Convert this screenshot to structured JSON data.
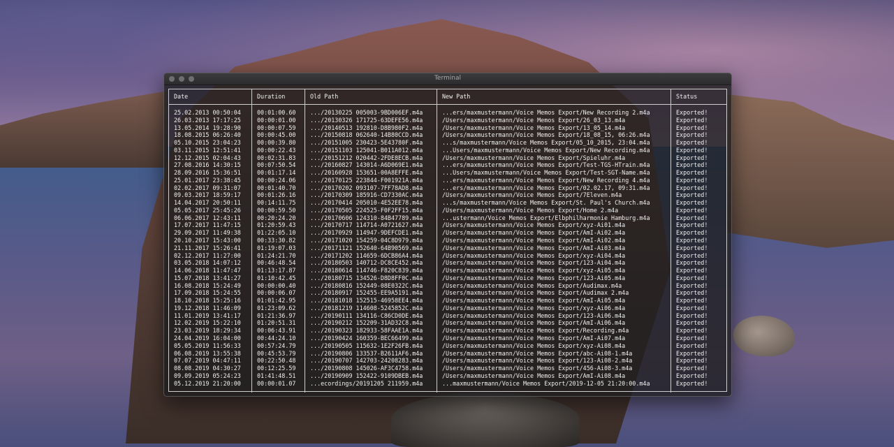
{
  "window": {
    "title": "Terminal"
  },
  "table": {
    "headers": [
      "Date",
      "Duration",
      "Old Path",
      "New Path",
      "Status"
    ],
    "rows": [
      [
        "25.02.2013 00:50:04",
        "00:01:00.60",
        ".../20130225 005003-9BD006EF.m4a",
        "...ers/maxmustermann/Voice Memos Export/New Recording 2.m4a",
        "Exported!"
      ],
      [
        "26.03.2013 17:17:25",
        "00:00:01.00",
        ".../20130326 171725-63DEFE56.m4a",
        "/Users/maxmustermann/Voice Memos Export/26_03_13.m4a",
        "Exported!"
      ],
      [
        "13.05.2014 19:28:90",
        "00:00:07.59",
        ".../20140513 192810-D8B980F2.m4a",
        "/Users/maxmustermann/Voice Memos Export/13_05_14.m4a",
        "Exported!"
      ],
      [
        "18.08.2015 06:26:40",
        "00:00:45.00",
        ".../20150818 062640-14B80CCD.m4a",
        "/Users/maxmustermann/Voice Memos Export/18_08_15, 06:26.m4a",
        "Exported!"
      ],
      [
        "05.10.2015 23:04:23",
        "00:00:39.80",
        ".../20151005 230423-5E43780F.m4a",
        "...s/maxmustermann/Voice Memos Export/05_10_2015, 23:04.m4a",
        "Exported!"
      ],
      [
        "03.11.2015 12:51:41",
        "00:00:22.43",
        ".../20151103 125041-B011A012.m4a",
        "...Users/maxmustermann/Voice Memos Export/New Recording.m4a",
        "Exported!"
      ],
      [
        "12.12.2015 02:04:43",
        "00:02:31.83",
        ".../20151212 020442-2FDE8ECB.m4a",
        "/Users/maxmustermann/Voice Memos Export/Spieluhr.m4a",
        "Exported!"
      ],
      [
        "27.08.2016 14:30:15",
        "00:07:50.54",
        ".../20160827 143014-A6D069E1.m4a",
        "...ers/maxmustermann/Voice Memos Export/Test-TGS-HTrain.m4a",
        "Exported!"
      ],
      [
        "28.09.2016 15:36:51",
        "00:01:17.14",
        ".../20160928 153651-00A8EFFE.m4a",
        "...Users/maxmustermann/Voice Memos Export/Test-SGT-Name.m4a",
        "Exported!"
      ],
      [
        "25.01.2017 23:38:45",
        "00:00:24.06",
        ".../20170125 223844-F001921A.m4a",
        "...ers/maxmustermann/Voice Memos Export/New Recording 4.m4a",
        "Exported!"
      ],
      [
        "02.02.2017 09:31:07",
        "00:01:40.70",
        ".../20170202 093107-7FF78AD8.m4a",
        "...ers/maxmustermann/Voice Memos Export/02.02.17, 09:31.m4a",
        "Exported!"
      ],
      [
        "09.03.2017 18:59:17",
        "00:01:26.16",
        ".../20170309 185916-CD7330AC.m4a",
        "/Users/maxmustermann/Voice Memos Export/7Eleven.m4a",
        "Exported!"
      ],
      [
        "14.04.2017 20:50:11",
        "00:14:11.75",
        ".../20170414 205010-4E52EE78.m4a",
        "...s/maxmustermann/Voice Memos Export/St. Paul's Church.m4a",
        "Exported!"
      ],
      [
        "05.05.2017 25:45:26",
        "00:00:59.50",
        ".../20170505 224525-F0F2FF15.m4a",
        "/Users/maxmustermann/Voice Memos Export/Home 2.m4a",
        "Exported!"
      ],
      [
        "06.06.2017 12:43:11",
        "00:20:24.20",
        ".../20170606 124310-84B47789.m4a",
        "...ustermann/Voice Memos Export/Elbphilharmonie Hamburg.m4a",
        "Exported!"
      ],
      [
        "17.07.2017 11:47:15",
        "01:20:59.43",
        ".../20170717 114714-A0721627.m4a",
        "/Users/maxmustermann/Voice Memos Export/xyz-Ai01.m4a",
        "Exported!"
      ],
      [
        "29.09.2017 11:49:38",
        "01:22:05.10",
        ".../20170929 114947-9DEFCDE1.m4a",
        "/Users/maxmustermann/Voice Memos Export/AmI-Ai02.m4a",
        "Exported!"
      ],
      [
        "20.10.2017 15:43:00",
        "00:33:30.82",
        ".../20171020 154259-04C8D979.m4a",
        "/Users/maxmustermann/Voice Memos Export/AmI-Ai02.m4a",
        "Exported!"
      ],
      [
        "21.11.2017 15:26:41",
        "01:19:07.03",
        ".../20171121 152640-64B90569.m4a",
        "/Users/maxmustermann/Voice Memos Export/AmI-Ai03.m4a",
        "Exported!"
      ],
      [
        "02.12.2017 11:27:00",
        "01:24:21.70",
        ".../20171202 114659-6DCB86A4.m4a",
        "/Users/maxmustermann/Voice Memos Export/xyz-Ai04.m4a",
        "Exported!"
      ],
      [
        "03.05.2018 14:07:12",
        "00:46:48.54",
        ".../20180503 140712-DC8CE452.m4a",
        "/Users/maxmustermann/Voice Memos Export/123-Ai04.m4a",
        "Exported!"
      ],
      [
        "14.06.2018 11:47:47",
        "01:13:17.87",
        ".../20180614 114746-F820C839.m4a",
        "/Users/maxmustermann/Voice Memos Export/xyz-Ai05.m4a",
        "Exported!"
      ],
      [
        "15.07.2018 13:41:27",
        "01:10:42.45",
        ".../20180715 134526-D8D8FF0C.m4a",
        "/Users/maxmustermann/Voice Memos Export/123-Ai05.m4a",
        "Exported!"
      ],
      [
        "16.08.2018 15:24:49",
        "00:00:00.40",
        ".../20180816 152449-08E0322C.m4a",
        "/Users/maxmustermann/Voice Memos Export/Audimax.m4a",
        "Exported!"
      ],
      [
        "17.09.2018 15:24:55",
        "00:00:06.07",
        ".../20180917 152455-EE9A5191.m4a",
        "/Users/maxmustermann/Voice Memos Export/Audimax 2.m4a",
        "Exported!"
      ],
      [
        "18.10.2018 15:25:16",
        "01:01:42.95",
        ".../20181018 152515-46958EE4.m4a",
        "/Users/maxmustermann/Voice Memos Export/AmI-Ai05.m4a",
        "Exported!"
      ],
      [
        "19.12.2018 11:46:09",
        "01:23:09.62",
        ".../20181219 114608-5245852C.m4a",
        "/Users/maxmustermann/Voice Memos Export/xyz-Ai06.m4a",
        "Exported!"
      ],
      [
        "11.01.2019 13:41:17",
        "01:21:36.97",
        ".../20190111 134116-C86CD0DE.m4a",
        "/Users/maxmustermann/Voice Memos Export/123-Ai06.m4a",
        "Exported!"
      ],
      [
        "12.02.2019 15:22:10",
        "01:20:51.31",
        ".../20190212 152209-31AD32C8.m4a",
        "/Users/maxmustermann/Voice Memos Export/AmI-Ai06.m4a",
        "Exported!"
      ],
      [
        "23.03.2019 18:29:34",
        "00:06:43.91",
        ".../20190323 182933-58FAAE1A.m4a",
        "/Users/maxmustermann/Voice Memos Export/Recording.m4a",
        "Exported!"
      ],
      [
        "24.04.2019 16:04:00",
        "00:44:24.10",
        ".../20190424 160359-BEC66499.m4a",
        "/Users/maxmustermann/Voice Memos Export/AmI-Ai07.m4a",
        "Exported!"
      ],
      [
        "05.05.2019 11:56:33",
        "00:57:24.79",
        ".../20190505 115632-1E2F26FB.m4a",
        "/Users/maxmustermann/Voice Memos Export/xyz-Ai08.m4a",
        "Exported!"
      ],
      [
        "06.08.2019 13:55:38",
        "00:45:53.79",
        ".../20190806 133537-B2611AF6.m4a",
        "/Users/maxmustermann/Voice Memos Export/abc-Ai08-1.m4a",
        "Exported!"
      ],
      [
        "07.07.2019 04:47:11",
        "00:22:50.48",
        ".../20190707 142703-24208283.m4a",
        "/Users/maxmustermann/Voice Memos Export/123-Ai08-2.m4a",
        "Exported!"
      ],
      [
        "08.08.2019 04:30:27",
        "00:12:25.59",
        ".../20190808 145026-AF3C4758.m4a",
        "/Users/maxmustermann/Voice Memos Export/456-Ai08-3.m4a",
        "Exported!"
      ],
      [
        "09.09.2019 05:24:23",
        "01:41:48.51",
        ".../20190909 152422-9109DBEB.m4a",
        "/Users/maxmustermann/Voice Memos Export/AmI-Ai08.m4a",
        "Exported!"
      ],
      [
        "05.12.2019 21:20:00",
        "00:00:01.07",
        "...ecordings/20191205 211959.m4a",
        "...maxmustermann/Voice Memos Export/2019-12-05 21:20:00.m4a",
        "Exported!"
      ]
    ]
  }
}
